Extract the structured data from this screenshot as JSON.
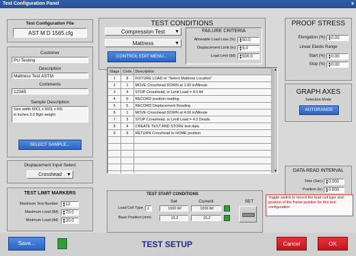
{
  "window": {
    "title": "Test Configuration Panel",
    "close_glyph": "x"
  },
  "config_file": {
    "label": "Test Configuration File",
    "value": "AST M D 1565.cfg"
  },
  "customer": {
    "label": "Customer",
    "value": "PU Testing"
  },
  "description": {
    "label": "Description",
    "value": "Mattress Test ASTM"
  },
  "comments": {
    "label": "Comments",
    "value": "12345"
  },
  "sample_description": {
    "label": "Sample Description",
    "lines": [
      "Size width 50CL x 500L x 50L",
      "in inches 3.0 Bgin weight"
    ]
  },
  "select_sample_button": "SELECT SAMPLE...",
  "displacement": {
    "label": "Displacement Input Select",
    "value": "Crosshead"
  },
  "test_limit_markers": {
    "title": "TEST LIMIT MARKERS",
    "rows": [
      {
        "label": "Maximum Test Number",
        "value": "12"
      },
      {
        "label": "Maximum Load (lbf)",
        "value": "70.0"
      },
      {
        "label": "Minimum Load (lbf)",
        "value": "20.0"
      }
    ]
  },
  "test_conditions": {
    "title": "TEST CONDITIONS",
    "test_type": "Compression Test",
    "specimen": "Mattress",
    "control_button": "CONTROL EDIT MENU..."
  },
  "failure_criteria": {
    "title": "FAILURE CRITERIA",
    "rows": [
      {
        "label": "Allowable Load Loss (%)",
        "value": "50.0"
      },
      {
        "label": "Displacement Limit (in)",
        "value": "5.0"
      },
      {
        "label": "Load Limit (lbf)",
        "value": "500.0"
      }
    ]
  },
  "steps": {
    "headers": [
      "Stage",
      "Code",
      "Description"
    ],
    "rows": [
      [
        "1",
        "8",
        "FIXTURE LOAD or \"Select Mattress Location\""
      ],
      [
        "2",
        "1",
        "MOVE Crosshead DOWN at 1.00 in/Minute"
      ],
      [
        "3",
        "4",
        "STOP Crosshead, or Limit Load = 4.5 lbf"
      ],
      [
        "4",
        "6",
        "RECORD position reading"
      ],
      [
        "5",
        "5",
        "RECORD Displacement Reading"
      ],
      [
        "6",
        "1",
        "MOVE Crosshead DOWN at 4.00 in/Minute"
      ],
      [
        "7",
        "3",
        "STOP Crosshead, or Limit Load = 4.5 Deads"
      ],
      [
        "8",
        "4",
        "CREATE TEST AND STORE test data"
      ],
      [
        "9",
        "9",
        "RETURN Crosshead to HOME position"
      ],
      [
        "",
        "",
        ""
      ],
      [
        "",
        "",
        ""
      ],
      [
        "",
        "",
        ""
      ],
      [
        "",
        "",
        ""
      ],
      [
        "",
        "",
        ""
      ],
      [
        "",
        "",
        ""
      ]
    ]
  },
  "test_start": {
    "title": "TEST START CONDITIONS",
    "col_set": "Set",
    "col_current": "Current",
    "rows": [
      {
        "label": "Load Cell Type",
        "index": "1",
        "set": "1000 lbf",
        "current": "1000 lbf"
      },
      {
        "label": "Base Position (mm)",
        "index": "",
        "set": "15.2",
        "current": "15.2"
      }
    ],
    "set_label": "SET"
  },
  "proof_stress": {
    "title": "PROOF STRESS",
    "elongation_label": "Elongation (%)",
    "elongation_value": "0.00",
    "range_title": "Linear Elastic Range",
    "start_label": "Start (%)",
    "start_value": "0.00",
    "stop_label": "Stop (%)",
    "stop_value": "0.00"
  },
  "graph_axes": {
    "title": "GRAPH AXES",
    "selection_label": "Selection Mode",
    "button": "AUTORANGE"
  },
  "data_interval": {
    "title": "DATA READ INTERVAL",
    "rows": [
      {
        "label": "Time (Sec)",
        "value": "0.000"
      },
      {
        "label": "Position (in)",
        "value": "0.000"
      }
    ]
  },
  "toggle_note": "Toggle switch to record the load cell type and position of the frame position for this test configuration",
  "bottom": {
    "save_button": "Save...",
    "center_title": "TEST SETUP",
    "cancel_button": "Cancel",
    "ok_button": "OK"
  },
  "colors": {
    "accent_blue": "#2d64c4",
    "green": "#2f9e3a",
    "red": "#c0161c",
    "panel": "#d3d3d3"
  }
}
